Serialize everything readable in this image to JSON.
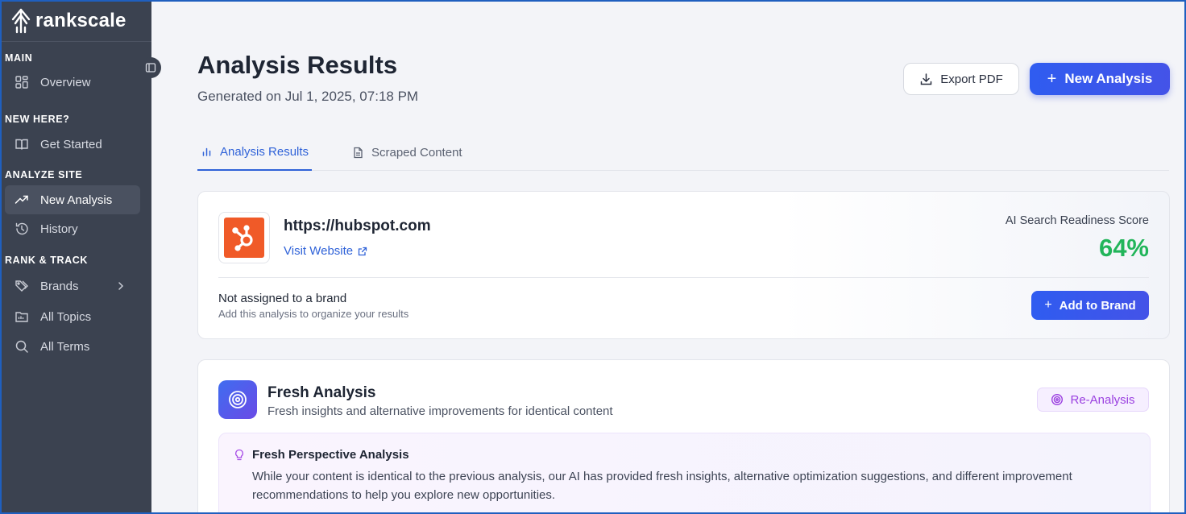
{
  "sidebar": {
    "brand_name": "rankscale",
    "sections": [
      {
        "title": "MAIN"
      },
      {
        "title": "NEW HERE?"
      },
      {
        "title": "ANALYZE SITE"
      },
      {
        "title": "RANK & TRACK"
      }
    ],
    "items": [
      {
        "label": "Overview",
        "icon": "grid-icon"
      },
      {
        "label": "Get Started",
        "icon": "book-icon"
      },
      {
        "label": "New Analysis",
        "icon": "trend-up-icon",
        "active": true
      },
      {
        "label": "History",
        "icon": "history-icon"
      },
      {
        "label": "Brands",
        "icon": "tag-icon"
      },
      {
        "label": "All Topics",
        "icon": "folder-icon"
      },
      {
        "label": "All Terms",
        "icon": "search-icon"
      }
    ]
  },
  "header": {
    "title": "Analysis Results",
    "generated": "Generated on Jul 1, 2025, 07:18 PM",
    "export_label": "Export PDF",
    "new_label": "New Analysis"
  },
  "tabs": [
    {
      "label": "Analysis Results",
      "active": true
    },
    {
      "label": "Scraped Content",
      "active": false
    }
  ],
  "site_card": {
    "url": "https://hubspot.com",
    "visit_label": "Visit Website",
    "score_label": "AI Search Readiness Score",
    "score_value": "64%",
    "score_color": "#22b55a",
    "brand_status": "Not assigned to a brand",
    "brand_hint": "Add this analysis to organize your results",
    "add_brand_label": "Add to Brand"
  },
  "fresh": {
    "title": "Fresh Analysis",
    "subtitle": "Fresh insights and alternative improvements for identical content",
    "reanalysis_label": "Re-Analysis",
    "perspective_title": "Fresh Perspective Analysis",
    "perspective_body": "While your content is identical to the previous analysis, our AI has provided fresh insights, alternative optimization suggestions, and different improvement recommendations to help you explore new opportunities."
  },
  "colors": {
    "accent": "#2f5cf0",
    "sidebar_bg": "#3b4250",
    "hubspot_orange": "#f05a28",
    "reanalysis_purple": "#9a3fe0"
  }
}
